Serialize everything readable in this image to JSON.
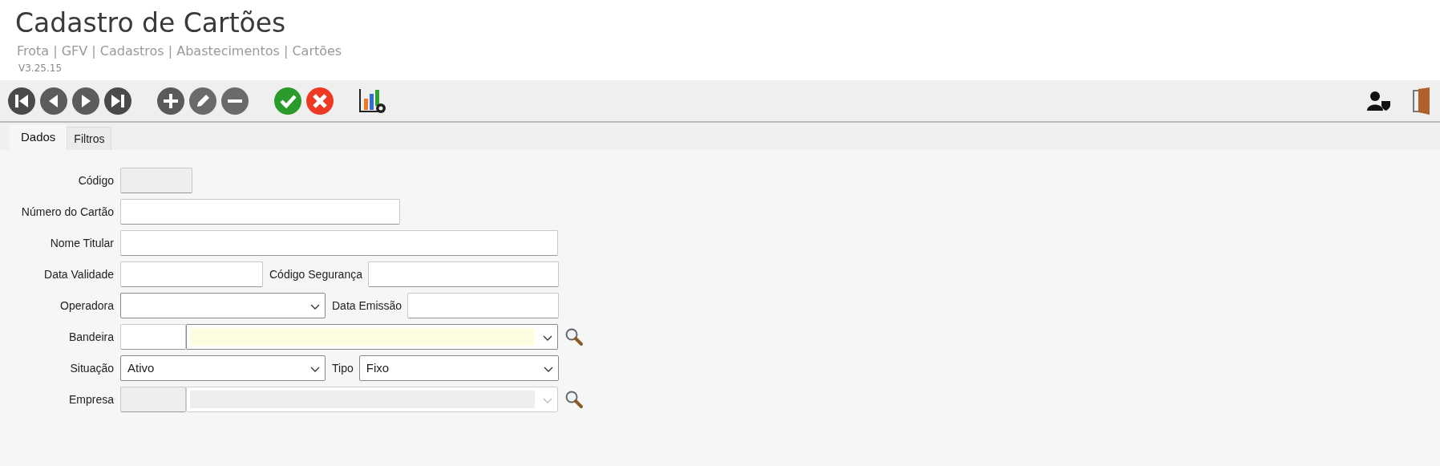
{
  "header": {
    "title": "Cadastro de Cartões",
    "breadcrumb": "Frota | GFV | Cadastros | Abastecimentos | Cartões",
    "version": "V3.25.15"
  },
  "tabs": [
    {
      "label": "Dados",
      "selected": true
    },
    {
      "label": "Filtros",
      "selected": false
    }
  ],
  "form": {
    "rows": [
      {
        "fields": [
          {
            "label": "Código",
            "kind": "text",
            "disabled": true
          }
        ]
      },
      {
        "fields": [
          {
            "label": "Número do Cartão",
            "kind": "text",
            "disabled": false
          }
        ]
      },
      {
        "fields": [
          {
            "label": "Nome Titular",
            "kind": "text",
            "disabled": false
          }
        ]
      },
      {
        "fields": [
          {
            "label": "Data Validade",
            "kind": "text",
            "disabled": false
          },
          {
            "label": "Código Segurança",
            "kind": "text",
            "disabled": false
          }
        ]
      },
      {
        "fields": [
          {
            "label": "Operadora",
            "kind": "select",
            "disabled": false
          },
          {
            "label": "Data Emissão",
            "kind": "text",
            "disabled": false
          }
        ]
      },
      {
        "fields": [
          {
            "label": "Bandeira",
            "kind": "lookup",
            "disabled": false,
            "required": true
          }
        ]
      },
      {
        "fields": [
          {
            "label": "Situação",
            "kind": "select",
            "disabled": false,
            "value": "Ativo"
          },
          {
            "label": "Tipo",
            "kind": "select",
            "disabled": false,
            "value": "Fixo"
          }
        ]
      },
      {
        "fields": [
          {
            "label": "Empresa",
            "kind": "lookup",
            "disabled": true
          }
        ]
      }
    ]
  }
}
